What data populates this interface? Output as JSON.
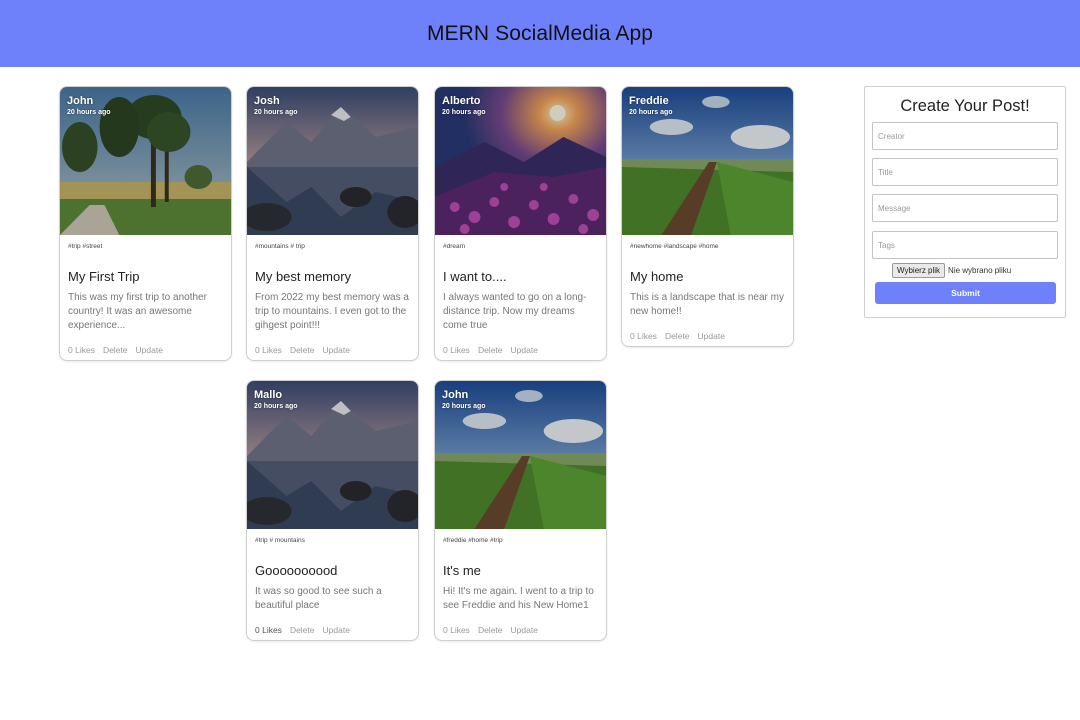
{
  "app": {
    "title": "MERN SocialMedia App"
  },
  "posts": [
    {
      "creator": "John",
      "time": "20 hours ago",
      "tags": "#trip #street",
      "title": "My First Trip",
      "message": "This was my first trip to another country! It was an awesome experience...",
      "likes": "0 Likes",
      "delete": "Delete",
      "update": "Update",
      "image": "trees-path-icon"
    },
    {
      "creator": "Josh",
      "time": "20 hours ago",
      "tags": "#mountains # trip",
      "title": "My best memory",
      "message": "From 2022 my best memory was a trip to mountains. I even got to the gihgest point!!!",
      "likes": "0 Likes",
      "delete": "Delete",
      "update": "Update",
      "image": "mountain-lake-icon"
    },
    {
      "creator": "Alberto",
      "time": "20 hours ago",
      "tags": "#dream",
      "title": "I want to....",
      "message": "I always wanted to go on a long-distance trip. Now my dreams come true",
      "likes": "0 Likes",
      "delete": "Delete",
      "update": "Update",
      "image": "flower-sunset-icon"
    },
    {
      "creator": "Freddie",
      "time": "20 hours ago",
      "tags": "#newhome #landscape #home",
      "title": "My home",
      "message": "This is a landscape that is near my new home!!",
      "likes": "0 Likes",
      "delete": "Delete",
      "update": "Update",
      "image": "field-road-icon"
    },
    {
      "creator": "Mallo",
      "time": "20 hours ago",
      "tags": "#trip # mountains",
      "title": "Goooooooood",
      "message": "It was so good to see such a beautiful place",
      "likes": "0 Likes",
      "delete": "Delete",
      "update": "Update",
      "image": "mountain-lake-icon"
    },
    {
      "creator": "John",
      "time": "20 hours ago",
      "tags": "#freddie #home #trip",
      "title": "It's me",
      "message": "Hi! It's me again. I went to a trip to see Freddie and his New Home1",
      "likes": "0 Likes",
      "delete": "Delete",
      "update": "Update",
      "image": "field-road-icon"
    }
  ],
  "form": {
    "title": "Create Your Post!",
    "creator_placeholder": "Creator",
    "title_placeholder": "Title",
    "message_placeholder": "Message",
    "tags_placeholder": "Tags",
    "file_button": "Wybierz plik",
    "file_status": "Nie wybrano pliku",
    "submit_label": "Submit"
  },
  "colors": {
    "accent": "#6f80fb"
  }
}
